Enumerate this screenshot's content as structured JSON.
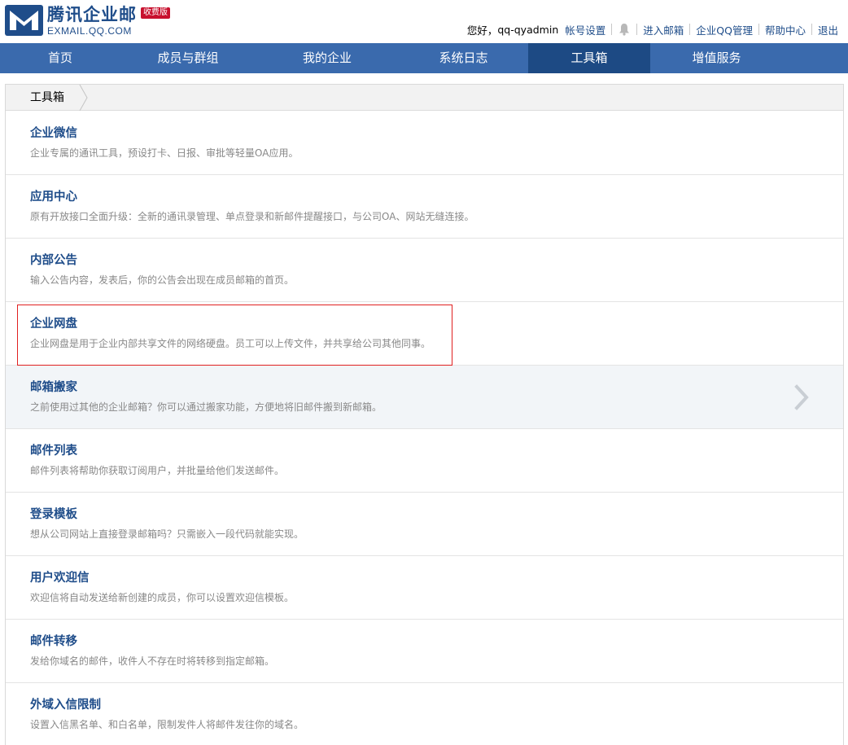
{
  "header": {
    "logo_title": "腾讯企业邮",
    "logo_badge": "收费版",
    "logo_sub": "EXMAIL.QQ.COM",
    "greeting": "您好，",
    "username": "qq-qyadmin",
    "links": [
      "帐号设置",
      "进入邮箱",
      "企业QQ管理",
      "帮助中心",
      "退出"
    ]
  },
  "nav": {
    "tabs": [
      "首页",
      "成员与群组",
      "我的企业",
      "系统日志",
      "工具箱",
      "增值服务"
    ],
    "active": "工具箱"
  },
  "breadcrumb": {
    "label": "工具箱"
  },
  "tools": [
    {
      "title": "企业微信",
      "desc": "企业专属的通讯工具，预设打卡、日报、审批等轻量OA应用。"
    },
    {
      "title": "应用中心",
      "desc": "原有开放接口全面升级：全新的通讯录管理、单点登录和新邮件提醒接口，与公司OA、网站无缝连接。"
    },
    {
      "title": "内部公告",
      "desc": "输入公告内容，发表后，你的公告会出现在成员邮箱的首页。"
    },
    {
      "title": "企业网盘",
      "desc": "企业网盘是用于企业内部共享文件的网络硬盘。员工可以上传文件，并共享给公司其他同事。"
    },
    {
      "title": "邮箱搬家",
      "desc": "之前使用过其他的企业邮箱？你可以通过搬家功能，方便地将旧邮件搬到新邮箱。"
    },
    {
      "title": "邮件列表",
      "desc": "邮件列表将帮助你获取订阅用户，并批量给他们发送邮件。"
    },
    {
      "title": "登录模板",
      "desc": "想从公司网站上直接登录邮箱吗？只需嵌入一段代码就能实现。"
    },
    {
      "title": "用户欢迎信",
      "desc": "欢迎信将自动发送给新创建的成员，你可以设置欢迎信模板。"
    },
    {
      "title": "邮件转移",
      "desc": "发给你域名的邮件，收件人不存在时将转移到指定邮箱。"
    },
    {
      "title": "外域入信限制",
      "desc": "设置入信黑名单、和白名单，限制发件人将邮件发往你的域名。"
    }
  ],
  "hovered_item": "邮箱搬家",
  "highlighted_item": "企业网盘",
  "colors": {
    "brand_blue": "#1f4d8a",
    "nav_bg": "#3a6aad",
    "nav_active": "#1d4a84",
    "badge_red": "#c8102e",
    "highlight_border": "#e02020",
    "hover_row": "#f2f5f8"
  },
  "icons": [
    "logo-mark-icon",
    "bell-icon",
    "breadcrumb-arrow-icon",
    "chevron-right-icon"
  ]
}
